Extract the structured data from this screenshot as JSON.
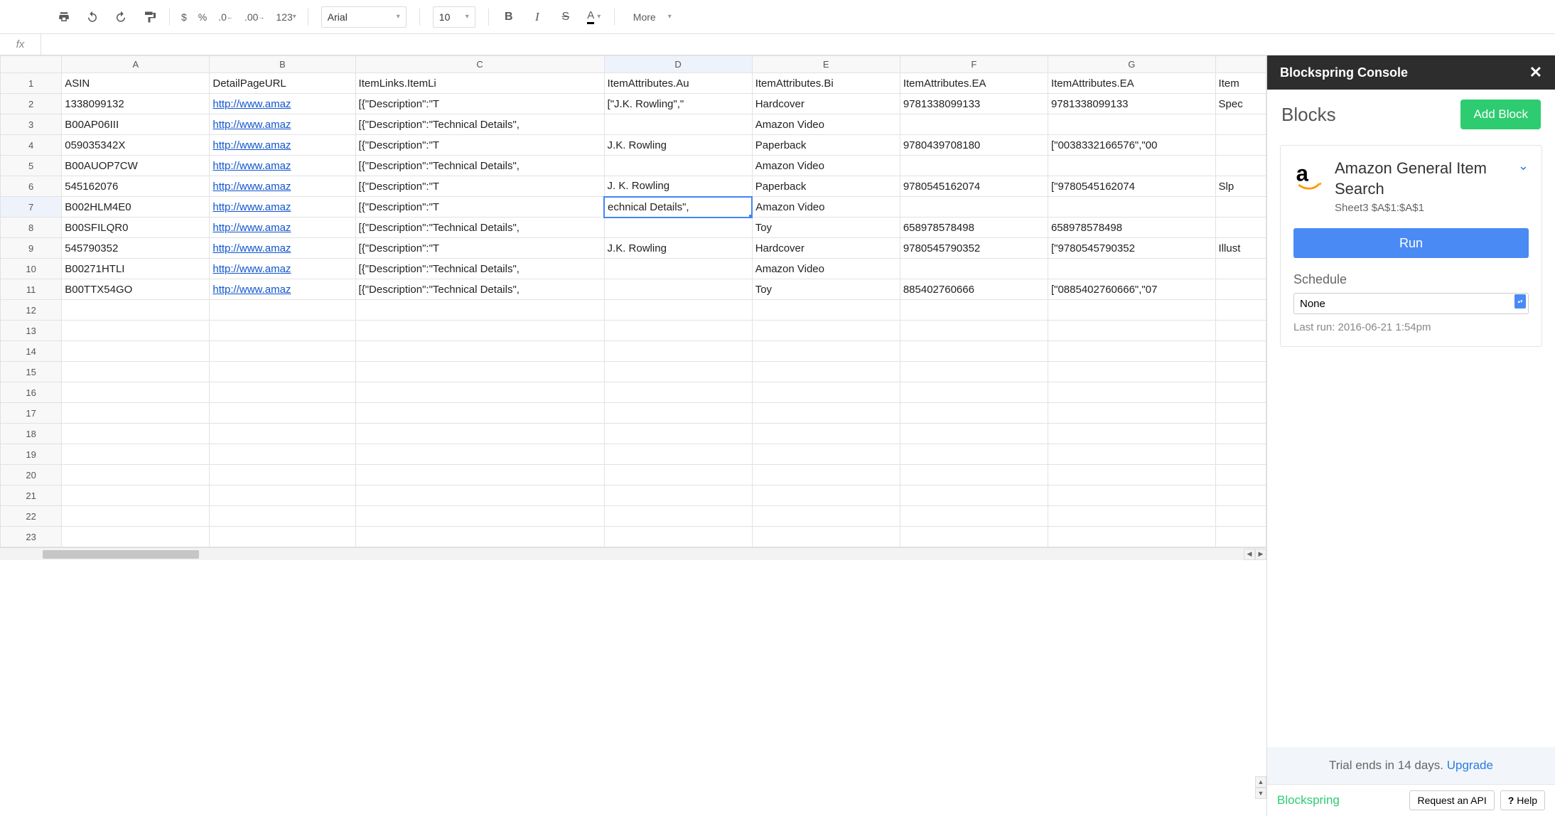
{
  "toolbar": {
    "currency": "$",
    "percent": "%",
    "dec_dec": ".0",
    "dec_inc": ".00",
    "num_fmt": "123",
    "font_name": "Arial",
    "font_size": "10",
    "bold": "B",
    "italic": "I",
    "strike": "S",
    "text_color": "A",
    "more": "More"
  },
  "fx": {
    "value": ""
  },
  "columns": [
    "A",
    "B",
    "C",
    "D",
    "E",
    "F",
    "G",
    ""
  ],
  "selected": {
    "row": 7,
    "col": 3
  },
  "rows": [
    {
      "n": 1,
      "cells": [
        "ASIN",
        "DetailPageURL",
        "ItemLinks.ItemLi",
        "ItemAttributes.Au",
        "ItemAttributes.Bi",
        "ItemAttributes.EA",
        "ItemAttributes.EA",
        "Item"
      ]
    },
    {
      "n": 2,
      "cells": [
        "1338099132",
        "http://www.amaz",
        "[{\"Description\":\"T",
        "[\"J.K. Rowling\",\"",
        "Hardcover",
        "9781338099133",
        "9781338099133",
        "Spec"
      ],
      "num_cols": [
        0
      ],
      "link_cols": [
        1
      ]
    },
    {
      "n": 3,
      "cells": [
        "B00AP06III",
        "http://www.amaz",
        "[{\"Description\":\"Technical Details\",",
        "",
        "Amazon Video",
        "",
        "",
        ""
      ],
      "link_cols": [
        1
      ]
    },
    {
      "n": 4,
      "cells": [
        "059035342X",
        "http://www.amaz",
        "[{\"Description\":\"T",
        "J.K. Rowling",
        "Paperback",
        "9780439708180",
        "[\"0038332166576\",\"00",
        ""
      ],
      "link_cols": [
        1
      ]
    },
    {
      "n": 5,
      "cells": [
        "B00AUOP7CW",
        "http://www.amaz",
        "[{\"Description\":\"Technical Details\",",
        "",
        "Amazon Video",
        "",
        "",
        ""
      ],
      "link_cols": [
        1
      ]
    },
    {
      "n": 6,
      "cells": [
        "545162076",
        "http://www.amaz",
        "[{\"Description\":\"T",
        "J. K. Rowling",
        "Paperback",
        "9780545162074",
        "[\"9780545162074",
        "Slp"
      ],
      "num_cols": [
        0
      ],
      "link_cols": [
        1
      ]
    },
    {
      "n": 7,
      "cells": [
        "B002HLM4E0",
        "http://www.amaz",
        "[{\"Description\":\"T",
        "echnical Details\",",
        "Amazon Video",
        "",
        "",
        ""
      ],
      "link_cols": [
        1
      ]
    },
    {
      "n": 8,
      "cells": [
        "B00SFILQR0",
        "http://www.amaz",
        "[{\"Description\":\"Technical Details\",",
        "",
        "Toy",
        "658978578498",
        "658978578498",
        ""
      ],
      "link_cols": [
        1
      ],
      "num_cols": [
        5,
        6
      ]
    },
    {
      "n": 9,
      "cells": [
        "545790352",
        "http://www.amaz",
        "[{\"Description\":\"T",
        "J.K. Rowling",
        "Hardcover",
        "9780545790352",
        "[\"9780545790352",
        "Illust"
      ],
      "num_cols": [
        0
      ],
      "link_cols": [
        1
      ]
    },
    {
      "n": 10,
      "cells": [
        "B00271HTLI",
        "http://www.amaz",
        "[{\"Description\":\"Technical Details\",",
        "",
        "Amazon Video",
        "",
        "",
        ""
      ],
      "link_cols": [
        1
      ]
    },
    {
      "n": 11,
      "cells": [
        "B00TTX54GO",
        "http://www.amaz",
        "[{\"Description\":\"Technical Details\",",
        "",
        "Toy",
        "885402760666",
        "[\"0885402760666\",\"07",
        ""
      ],
      "link_cols": [
        1
      ],
      "num_cols": [
        5
      ]
    },
    {
      "n": 12,
      "cells": [
        "",
        "",
        "",
        "",
        "",
        "",
        "",
        ""
      ]
    },
    {
      "n": 13,
      "cells": [
        "",
        "",
        "",
        "",
        "",
        "",
        "",
        ""
      ]
    },
    {
      "n": 14,
      "cells": [
        "",
        "",
        "",
        "",
        "",
        "",
        "",
        ""
      ]
    },
    {
      "n": 15,
      "cells": [
        "",
        "",
        "",
        "",
        "",
        "",
        "",
        ""
      ]
    },
    {
      "n": 16,
      "cells": [
        "",
        "",
        "",
        "",
        "",
        "",
        "",
        ""
      ]
    },
    {
      "n": 17,
      "cells": [
        "",
        "",
        "",
        "",
        "",
        "",
        "",
        ""
      ]
    },
    {
      "n": 18,
      "cells": [
        "",
        "",
        "",
        "",
        "",
        "",
        "",
        ""
      ]
    },
    {
      "n": 19,
      "cells": [
        "",
        "",
        "",
        "",
        "",
        "",
        "",
        ""
      ]
    },
    {
      "n": 20,
      "cells": [
        "",
        "",
        "",
        "",
        "",
        "",
        "",
        ""
      ]
    },
    {
      "n": 21,
      "cells": [
        "",
        "",
        "",
        "",
        "",
        "",
        "",
        ""
      ]
    },
    {
      "n": 22,
      "cells": [
        "",
        "",
        "",
        "",
        "",
        "",
        "",
        ""
      ]
    },
    {
      "n": 23,
      "cells": [
        "",
        "",
        "",
        "",
        "",
        "",
        "",
        ""
      ]
    }
  ],
  "panel": {
    "title": "Blockspring Console",
    "blocks_heading": "Blocks",
    "add_block": "Add Block",
    "block": {
      "name": "Amazon General Item Search",
      "range": "Sheet3 $A$1:$A$1",
      "run": "Run",
      "schedule_label": "Schedule",
      "schedule_value": "None",
      "last_run": "Last run: 2016-06-21 1:54pm"
    },
    "trial": {
      "text": "Trial ends in 14 days. ",
      "link": "Upgrade"
    },
    "footer": {
      "brand": "Blockspring",
      "request": "Request an API",
      "help": "Help"
    }
  }
}
